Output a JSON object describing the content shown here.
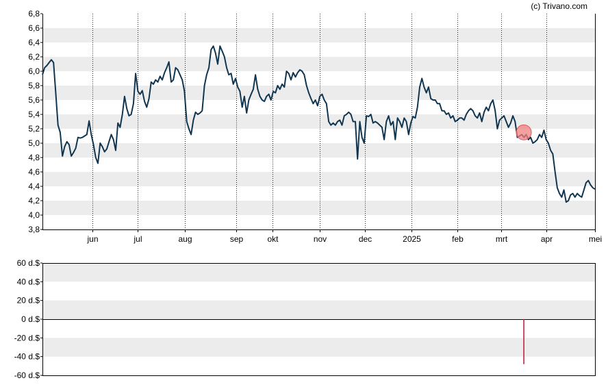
{
  "credit": "(c) Trivano.com",
  "chart_data": [
    {
      "type": "line",
      "title": "",
      "xlabel": "",
      "ylabel": "",
      "ylim": [
        3.8,
        6.8
      ],
      "yticks": [
        "6,8",
        "6,6",
        "6,4",
        "6,2",
        "6,0",
        "5,8",
        "5,6",
        "5,4",
        "5,2",
        "5,0",
        "4,8",
        "4,6",
        "4,4",
        "4,2",
        "4,0",
        "3,8"
      ],
      "ytick_values": [
        6.8,
        6.6,
        6.4,
        6.2,
        6.0,
        5.8,
        5.6,
        5.4,
        5.2,
        5.0,
        4.8,
        4.6,
        4.4,
        4.2,
        4.0,
        3.8
      ],
      "xlim": [
        0,
        365
      ],
      "x_ticks": [
        {
          "label": "jun",
          "x": 33
        },
        {
          "label": "jul",
          "x": 63
        },
        {
          "label": "aug",
          "x": 94
        },
        {
          "label": "sep",
          "x": 128
        },
        {
          "label": "okt",
          "x": 152
        },
        {
          "label": "nov",
          "x": 183
        },
        {
          "label": "dec",
          "x": 213
        },
        {
          "label": "2025",
          "x": 244
        },
        {
          "label": "feb",
          "x": 274
        },
        {
          "label": "mrt",
          "x": 303
        },
        {
          "label": "apr",
          "x": 333
        },
        {
          "label": "mei",
          "x": 365
        }
      ],
      "grid": true,
      "line_color": "#0f3550",
      "marker": {
        "x": 318,
        "y": 5.15,
        "color": "#f08080"
      },
      "series": [
        {
          "name": "",
          "points": [
            [
              0,
              5.95
            ],
            [
              1,
              6.05
            ],
            [
              2,
              6.08
            ],
            [
              3,
              6.12
            ],
            [
              4,
              6.16
            ],
            [
              5,
              6.12
            ],
            [
              6,
              5.7
            ],
            [
              7,
              5.25
            ],
            [
              8,
              5.15
            ],
            [
              9,
              4.82
            ],
            [
              10,
              4.95
            ],
            [
              11,
              5.02
            ],
            [
              12,
              4.98
            ],
            [
              13,
              4.82
            ],
            [
              14,
              4.87
            ],
            [
              15,
              4.93
            ],
            [
              16,
              5.08
            ],
            [
              17,
              5.07
            ],
            [
              18,
              5.08
            ],
            [
              19,
              5.1
            ],
            [
              20,
              5.12
            ],
            [
              21,
              5.31
            ],
            [
              22,
              5.12
            ],
            [
              23,
              4.98
            ],
            [
              24,
              4.8
            ],
            [
              25,
              4.72
            ],
            [
              26,
              5.0
            ],
            [
              27,
              4.95
            ],
            [
              28,
              4.88
            ],
            [
              29,
              4.92
            ],
            [
              30,
              5.02
            ],
            [
              31,
              5.12
            ],
            [
              32,
              5.05
            ],
            [
              33,
              4.9
            ],
            [
              34,
              5.28
            ],
            [
              35,
              5.22
            ],
            [
              36,
              5.4
            ],
            [
              37,
              5.65
            ],
            [
              38,
              5.48
            ],
            [
              39,
              5.38
            ],
            [
              40,
              5.4
            ],
            [
              41,
              5.55
            ],
            [
              42,
              5.97
            ],
            [
              43,
              5.72
            ],
            [
              44,
              5.68
            ],
            [
              45,
              5.73
            ],
            [
              46,
              5.58
            ],
            [
              47,
              5.5
            ],
            [
              48,
              5.62
            ],
            [
              49,
              5.85
            ],
            [
              50,
              5.82
            ],
            [
              51,
              5.88
            ],
            [
              52,
              5.85
            ],
            [
              53,
              5.93
            ],
            [
              54,
              5.88
            ],
            [
              55,
              5.98
            ],
            [
              56,
              6.05
            ],
            [
              57,
              6.13
            ],
            [
              58,
              5.85
            ],
            [
              59,
              5.88
            ],
            [
              60,
              6.05
            ],
            [
              61,
              6.02
            ],
            [
              62,
              5.95
            ],
            [
              63,
              5.88
            ],
            [
              64,
              5.72
            ],
            [
              65,
              5.3
            ],
            [
              66,
              5.2
            ],
            [
              67,
              5.12
            ],
            [
              68,
              5.32
            ],
            [
              69,
              5.43
            ],
            [
              70,
              5.4
            ],
            [
              71,
              5.42
            ],
            [
              72,
              5.45
            ],
            [
              73,
              5.8
            ],
            [
              74,
              5.95
            ],
            [
              75,
              6.05
            ],
            [
              76,
              6.3
            ],
            [
              77,
              6.35
            ],
            [
              78,
              6.25
            ],
            [
              79,
              6.1
            ],
            [
              80,
              6.35
            ],
            [
              81,
              6.28
            ],
            [
              82,
              6.2
            ],
            [
              83,
              6.05
            ],
            [
              84,
              5.95
            ],
            [
              85,
              5.97
            ],
            [
              86,
              5.82
            ],
            [
              87,
              5.9
            ],
            [
              88,
              5.78
            ],
            [
              89,
              5.72
            ],
            [
              90,
              5.5
            ],
            [
              91,
              5.65
            ],
            [
              92,
              5.42
            ],
            [
              93,
              5.6
            ],
            [
              94,
              5.68
            ],
            [
              95,
              5.75
            ],
            [
              96,
              5.95
            ],
            [
              97,
              5.75
            ],
            [
              98,
              5.65
            ],
            [
              99,
              5.6
            ],
            [
              100,
              5.58
            ],
            [
              101,
              5.65
            ],
            [
              102,
              5.68
            ],
            [
              103,
              5.6
            ],
            [
              104,
              5.72
            ],
            [
              105,
              5.7
            ],
            [
              106,
              5.8
            ],
            [
              107,
              5.75
            ],
            [
              108,
              5.82
            ],
            [
              109,
              5.78
            ],
            [
              110,
              6.0
            ],
            [
              111,
              5.97
            ],
            [
              112,
              5.88
            ],
            [
              113,
              5.98
            ],
            [
              114,
              5.92
            ],
            [
              115,
              5.98
            ],
            [
              116,
              6.02
            ],
            [
              117,
              6.0
            ],
            [
              118,
              5.95
            ],
            [
              119,
              5.8
            ],
            [
              120,
              5.7
            ],
            [
              121,
              5.62
            ],
            [
              122,
              5.55
            ],
            [
              123,
              5.6
            ],
            [
              124,
              5.52
            ],
            [
              125,
              5.65
            ],
            [
              126,
              5.68
            ],
            [
              127,
              5.6
            ],
            [
              128,
              5.55
            ],
            [
              129,
              5.3
            ],
            [
              130,
              5.25
            ],
            [
              131,
              5.28
            ],
            [
              132,
              5.25
            ],
            [
              133,
              5.3
            ],
            [
              134,
              5.32
            ],
            [
              135,
              5.25
            ],
            [
              136,
              5.38
            ],
            [
              137,
              5.4
            ],
            [
              138,
              5.43
            ],
            [
              139,
              5.4
            ],
            [
              140,
              5.3
            ],
            [
              141,
              5.3
            ],
            [
              142,
              4.78
            ],
            [
              143,
              5.3
            ],
            [
              144,
              5.08
            ],
            [
              145,
              5.0
            ],
            [
              146,
              5.38
            ],
            [
              147,
              5.37
            ],
            [
              148,
              5.4
            ],
            [
              149,
              5.28
            ],
            [
              150,
              5.3
            ],
            [
              151,
              5.28
            ],
            [
              152,
              5.25
            ],
            [
              153,
              5.22
            ],
            [
              154,
              5.05
            ],
            [
              155,
              5.3
            ],
            [
              156,
              5.38
            ],
            [
              157,
              5.25
            ],
            [
              158,
              5.3
            ],
            [
              159,
              5.05
            ],
            [
              160,
              5.35
            ],
            [
              161,
              5.3
            ],
            [
              162,
              5.22
            ],
            [
              163,
              5.35
            ],
            [
              164,
              5.3
            ],
            [
              165,
              5.12
            ],
            [
              166,
              5.28
            ],
            [
              167,
              5.37
            ],
            [
              168,
              5.35
            ],
            [
              169,
              5.5
            ],
            [
              170,
              5.78
            ],
            [
              171,
              5.9
            ],
            [
              172,
              5.78
            ],
            [
              173,
              5.7
            ],
            [
              174,
              5.78
            ],
            [
              175,
              5.62
            ],
            [
              176,
              5.6
            ],
            [
              177,
              5.6
            ],
            [
              178,
              5.55
            ],
            [
              179,
              5.55
            ],
            [
              180,
              5.45
            ],
            [
              181,
              5.45
            ],
            [
              182,
              5.4
            ],
            [
              183,
              5.42
            ],
            [
              184,
              5.35
            ],
            [
              185,
              5.38
            ],
            [
              186,
              5.3
            ],
            [
              187,
              5.32
            ],
            [
              188,
              5.35
            ],
            [
              189,
              5.35
            ],
            [
              190,
              5.32
            ],
            [
              191,
              5.4
            ],
            [
              192,
              5.45
            ],
            [
              193,
              5.48
            ],
            [
              194,
              5.45
            ],
            [
              195,
              5.38
            ],
            [
              196,
              5.35
            ],
            [
              197,
              5.42
            ],
            [
              198,
              5.3
            ],
            [
              199,
              5.43
            ],
            [
              200,
              5.5
            ],
            [
              201,
              5.45
            ],
            [
              202,
              5.55
            ],
            [
              203,
              5.6
            ],
            [
              204,
              5.45
            ],
            [
              205,
              5.2
            ],
            [
              206,
              5.32
            ],
            [
              207,
              5.35
            ],
            [
              208,
              5.38
            ],
            [
              209,
              5.3
            ],
            [
              210,
              5.22
            ],
            [
              211,
              5.28
            ],
            [
              212,
              5.38
            ],
            [
              213,
              5.3
            ],
            [
              214,
              5.08
            ],
            [
              215,
              5.1
            ],
            [
              216,
              5.12
            ],
            [
              217,
              5.08
            ],
            [
              218,
              5.12
            ],
            [
              219,
              5.05
            ],
            [
              220,
              5.08
            ],
            [
              221,
              5.0
            ],
            [
              222,
              5.02
            ],
            [
              223,
              5.05
            ],
            [
              224,
              5.12
            ],
            [
              225,
              5.08
            ],
            [
              226,
              5.18
            ],
            [
              227,
              5.05
            ],
            [
              228,
              5.0
            ],
            [
              229,
              4.9
            ],
            [
              230,
              4.85
            ],
            [
              231,
              4.6
            ],
            [
              232,
              4.38
            ],
            [
              233,
              4.3
            ],
            [
              234,
              4.25
            ],
            [
              235,
              4.35
            ],
            [
              236,
              4.18
            ],
            [
              237,
              4.2
            ],
            [
              238,
              4.28
            ],
            [
              239,
              4.3
            ],
            [
              240,
              4.25
            ],
            [
              241,
              4.3
            ],
            [
              242,
              4.27
            ],
            [
              243,
              4.25
            ],
            [
              244,
              4.35
            ],
            [
              245,
              4.45
            ],
            [
              246,
              4.48
            ],
            [
              247,
              4.42
            ],
            [
              248,
              4.38
            ],
            [
              249,
              4.36
            ]
          ]
        }
      ]
    },
    {
      "type": "bar",
      "title": "",
      "xlabel": "",
      "ylabel": "",
      "ylim": [
        -60,
        60
      ],
      "yticks": [
        "60 d.$",
        "40 d.$",
        "20 d.$",
        "0 d.$",
        "-20 d.$",
        "-40 d.$",
        "-60 d.$"
      ],
      "ytick_values": [
        60,
        40,
        20,
        0,
        -20,
        -40,
        -60
      ],
      "xlim": [
        0,
        365
      ],
      "grid": true,
      "bars": [
        {
          "x": 318,
          "value": -48,
          "color": "#c8102e"
        }
      ]
    }
  ]
}
